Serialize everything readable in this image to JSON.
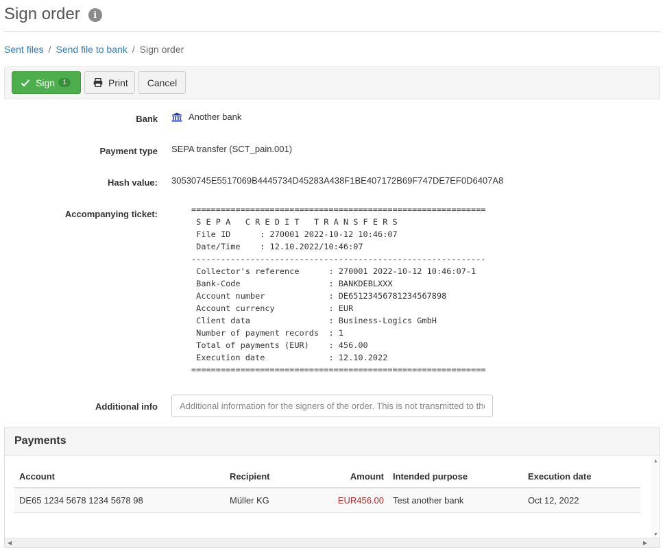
{
  "page": {
    "title": "Sign order",
    "info_icon_glyph": "i"
  },
  "breadcrumb": {
    "items": [
      "Sent files",
      "Send file to bank"
    ],
    "separator": "/",
    "current": "Sign order"
  },
  "toolbar": {
    "sign_label": "Sign",
    "sign_badge": "1",
    "print_label": "Print",
    "cancel_label": "Cancel"
  },
  "form": {
    "bank_label": "Bank",
    "bank_value": "Another bank",
    "payment_type_label": "Payment type",
    "payment_type_value": "SEPA transfer (SCT_pain.001)",
    "hash_label": "Hash value:",
    "hash_value": "30530745E5517069B4445734D45283A438F1BE407172B69F747DE7EF0D6407A8",
    "ticket_label": "Accompanying ticket:",
    "ticket_text": "============================================================\n S E P A   C R E D I T   T R A N S F E R S\n File ID      : 270001 2022-10-12 10:46:07\n Date/Time    : 12.10.2022/10:46:07\n------------------------------------------------------------\n Collector's reference      : 270001 2022-10-12 10:46:07-1\n Bank-Code                  : BANKDEBLXXX\n Account number             : DE65123456781234567898\n Account currency           : EUR\n Client data                : Business-Logics GmbH\n Number of payment records  : 1\n Total of payments (EUR)    : 456.00\n Execution date             : 12.10.2022\n============================================================",
    "additional_info_label": "Additional info",
    "additional_info_value": "",
    "additional_info_placeholder": "Additional information for the signers of the order. This is not transmitted to the bank."
  },
  "payments": {
    "title": "Payments",
    "columns": [
      "Account",
      "Recipient",
      "Amount",
      "Intended purpose",
      "Execution date"
    ],
    "rows": [
      {
        "account": "DE65 1234 5678 1234 5678 98",
        "recipient": "Müller KG",
        "amount": "EUR456.00",
        "purpose": "Test another bank",
        "execution_date": "Oct 12, 2022"
      }
    ]
  },
  "colors": {
    "primary_link": "#337ab7",
    "sign_button": "#4cae4c",
    "amount_negative": "#b52a2a",
    "bank_icon": "#1f3fb8"
  },
  "icons": {
    "info": "info-icon",
    "sign": "check-icon",
    "print": "printer-icon",
    "bank": "bank-icon"
  }
}
